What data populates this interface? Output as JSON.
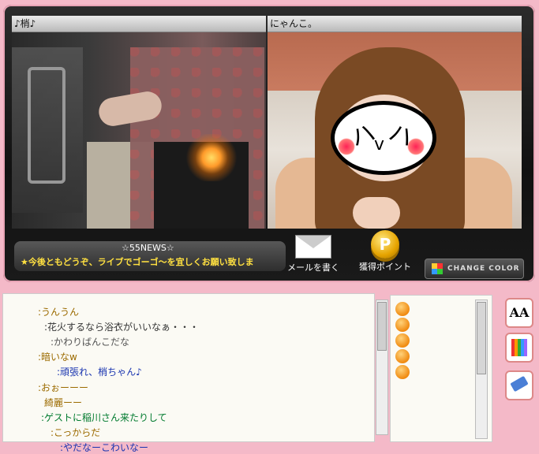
{
  "cams": {
    "left": {
      "name": "♪梢♪"
    },
    "right": {
      "name": "にゃんこ。"
    }
  },
  "face_mask": {
    "eye_left": "ハ",
    "eye_right": "ハ",
    "mouth": "v"
  },
  "news": {
    "title": "☆55NEWS☆",
    "text": "★今後ともどうぞ、ライブでゴーゴ～を宜しくお願い致しま"
  },
  "buttons": {
    "mail": "メールを書く",
    "points": "獲得ポイント",
    "coin_mark": "P",
    "change_color": "CHANGE COLOR"
  },
  "chat": [
    {
      "text": ":うんうん",
      "color": "#9c6b00"
    },
    {
      "text": ":花火するなら浴衣がいいなぁ・・・",
      "color": "#333333"
    },
    {
      "text": ":かわりばんこだな",
      "color": "#555555"
    },
    {
      "text": ":暗いなw",
      "color": "#9c6b00"
    },
    {
      "text": ":頑張れ、梢ちゃん♪",
      "color": "#1a35b0"
    },
    {
      "text": ":おぉーーー",
      "color": "#9c6b00"
    },
    {
      "text": "綺麗ーー",
      "color": "#9c6b00"
    },
    {
      "text": ":ゲストに稲川さん来たりして",
      "color": "#007a2e"
    },
    {
      "text": ":こっからだ",
      "color": "#9c6b00"
    },
    {
      "text": ":やだなーこわいなー",
      "color": "#1a35b0"
    }
  ],
  "tools": {
    "font_icon": "AA"
  }
}
